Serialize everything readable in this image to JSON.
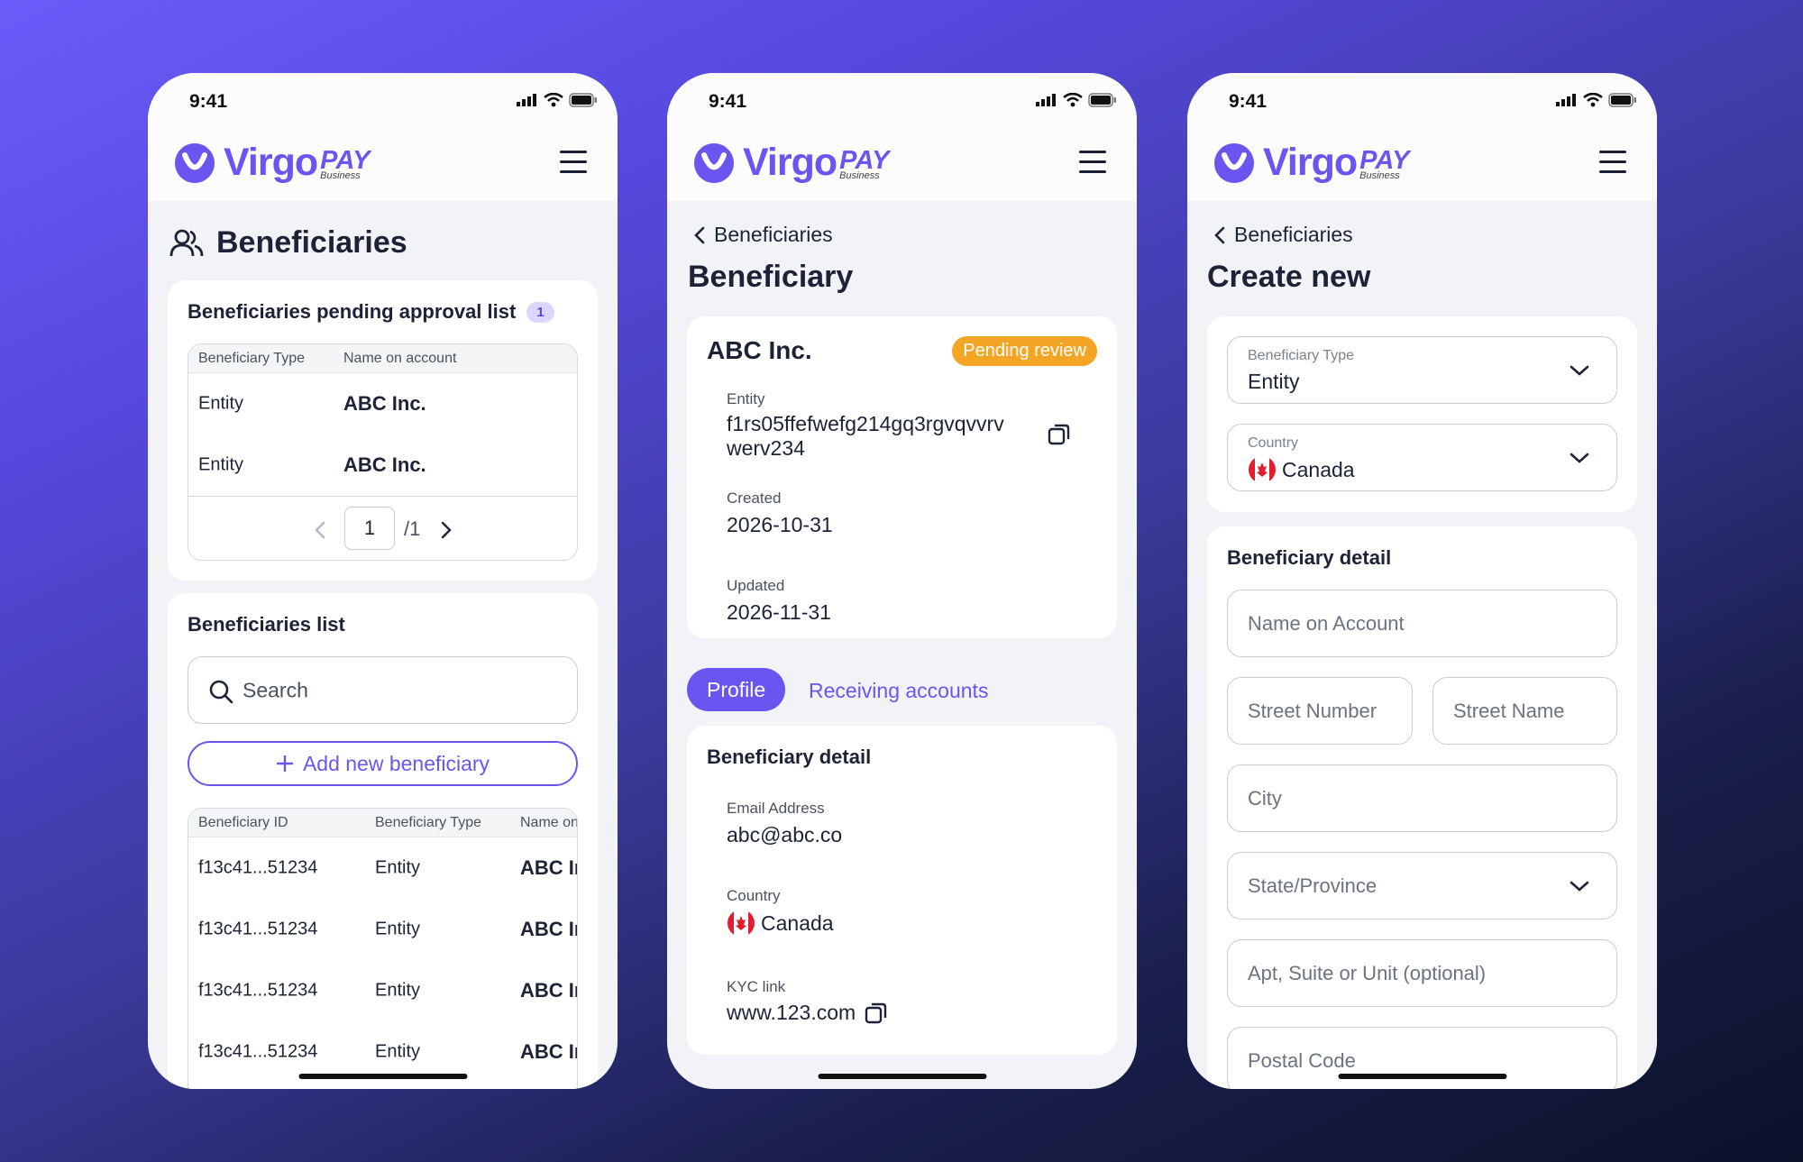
{
  "status": {
    "time": "9:41"
  },
  "logo": {
    "word": "Virgo",
    "pay": "PAY",
    "sub": "Business"
  },
  "colors": {
    "brand": "#6a55f0",
    "pending": "#f5a524",
    "text": "#1c2336"
  },
  "screen1": {
    "title": "Beneficiaries",
    "pending": {
      "title": "Beneficiaries pending approval list",
      "count": "1",
      "headers": [
        "Beneficiary Type",
        "Name on account"
      ],
      "rows": [
        {
          "type": "Entity",
          "name": "ABC Inc."
        },
        {
          "type": "Entity",
          "name": "ABC Inc."
        }
      ],
      "page": "1",
      "total": "/1"
    },
    "list": {
      "title": "Beneficiaries list",
      "search_placeholder": "Search",
      "add_label": "Add new beneficiary",
      "headers": [
        "Beneficiary ID",
        "Beneficiary Type",
        "Name on account"
      ],
      "rows": [
        {
          "id": "f13c41...51234",
          "type": "Entity",
          "name": "ABC Inc."
        },
        {
          "id": "f13c41...51234",
          "type": "Entity",
          "name": "ABC Inc."
        },
        {
          "id": "f13c41...51234",
          "type": "Entity",
          "name": "ABC Inc."
        },
        {
          "id": "f13c41...51234",
          "type": "Entity",
          "name": "ABC Inc."
        }
      ]
    }
  },
  "screen2": {
    "back": "Beneficiaries",
    "title": "Beneficiary",
    "name": "ABC Inc.",
    "badge": "Pending review",
    "entity_label": "Entity",
    "entity_value_1": "f1rs05ffefwefg214gq3rgvqvvrv",
    "entity_value_2": "werv234",
    "created_label": "Created",
    "created_value": "2026-10-31",
    "updated_label": "Updated",
    "updated_value": "2026-11-31",
    "tabs": [
      "Profile",
      "Receiving accounts"
    ],
    "detail_title": "Beneficiary detail",
    "email_label": "Email Address",
    "email_value": "abc@abc.co",
    "country_label": "Country",
    "country_value": "Canada",
    "kyc_label": "KYC link",
    "kyc_value": "www.123.com"
  },
  "screen3": {
    "back": "Beneficiaries",
    "title": "Create new",
    "type_label": "Beneficiary Type",
    "type_value": "Entity",
    "country_label": "Country",
    "country_value": "Canada",
    "detail_title": "Beneficiary detail",
    "placeholders": {
      "name": "Name on Account",
      "street_number": "Street Number",
      "street_name": "Street Name",
      "city": "City",
      "state": "State/Province",
      "apt": "Apt, Suite or Unit (optional)",
      "postal": "Postal Code"
    }
  }
}
